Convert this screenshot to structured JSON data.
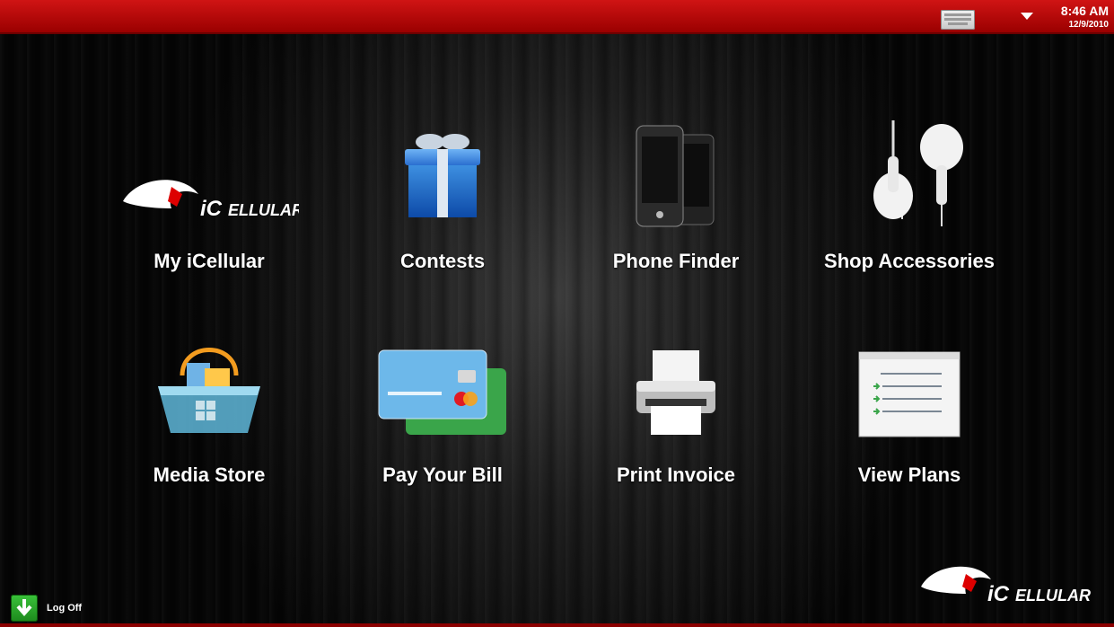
{
  "topbar": {
    "time": "8:46 AM",
    "date": "12/9/2010"
  },
  "tiles": [
    {
      "label": "My iCellular",
      "icon": "icellular-logo-icon"
    },
    {
      "label": "Contests",
      "icon": "gift-icon"
    },
    {
      "label": "Phone Finder",
      "icon": "phones-icon"
    },
    {
      "label": "Shop Accessories",
      "icon": "earbuds-icon"
    },
    {
      "label": "Media Store",
      "icon": "shopping-basket-icon"
    },
    {
      "label": "Pay Your Bill",
      "icon": "credit-cards-icon"
    },
    {
      "label": "Print Invoice",
      "icon": "printer-icon"
    },
    {
      "label": "View Plans",
      "icon": "document-list-icon"
    }
  ],
  "logo_text": "iCellular",
  "logoff": {
    "label": "Log Off"
  },
  "colors": {
    "accent": "#c00000",
    "topbar": "#b40000",
    "text": "#ffffff"
  }
}
